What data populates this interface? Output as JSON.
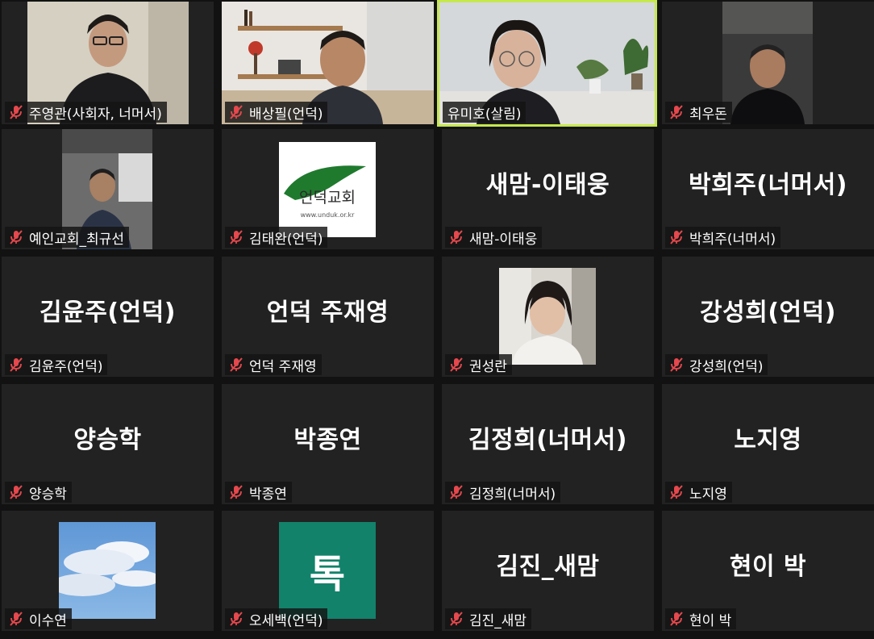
{
  "colors": {
    "background": "#121212",
    "tile": "#222222",
    "active_border": "#c6e84f",
    "mic_muted": "#e5484d"
  },
  "participants": [
    {
      "name": "주영관(사회자, 너머서)",
      "type": "video",
      "muted": true
    },
    {
      "name": "배상필(언덕)",
      "type": "video",
      "muted": true
    },
    {
      "name": "유미호(살림)",
      "type": "video",
      "muted": false,
      "active_speaker": true
    },
    {
      "name": "최우돈",
      "type": "video",
      "muted": true
    },
    {
      "name": "예인교회_최규선",
      "type": "video",
      "muted": true
    },
    {
      "name": "김태완(언덕)",
      "type": "avatar",
      "avatar_text": "언덕교회",
      "avatar_subtext": "www.unduk.or.kr",
      "muted": true
    },
    {
      "name": "새맘-이태웅",
      "type": "name",
      "muted": true
    },
    {
      "name": "박희주(너머서)",
      "type": "name",
      "muted": true
    },
    {
      "name": "김윤주(언덕)",
      "type": "name",
      "muted": true
    },
    {
      "name": "언덕 주재영",
      "type": "name",
      "muted": true
    },
    {
      "name": "권성란",
      "type": "avatar",
      "muted": true
    },
    {
      "name": "강성희(언덕)",
      "type": "name",
      "muted": true
    },
    {
      "name": "양승학",
      "type": "name",
      "muted": true
    },
    {
      "name": "박종연",
      "type": "name",
      "muted": true
    },
    {
      "name": "김정희(너머서)",
      "type": "name",
      "muted": true
    },
    {
      "name": "노지영",
      "type": "name",
      "muted": true
    },
    {
      "name": "이수연",
      "type": "avatar",
      "muted": true
    },
    {
      "name": "오세백(언덕)",
      "type": "avatar",
      "avatar_text": "톡",
      "muted": true
    },
    {
      "name": "김진_새맘",
      "type": "name",
      "muted": true
    },
    {
      "name": "현이 박",
      "type": "name",
      "muted": true
    }
  ]
}
